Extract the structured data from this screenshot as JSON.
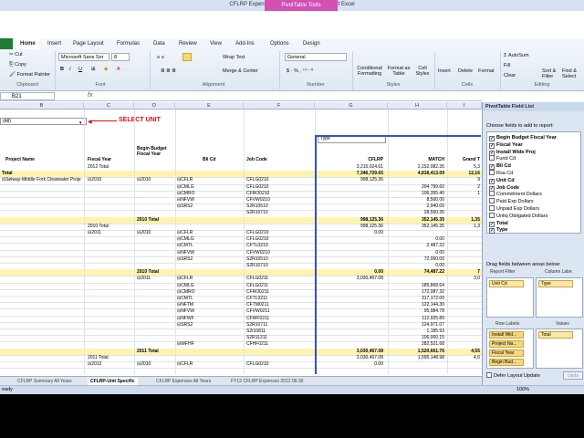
{
  "window": {
    "title": "CFLRP Expenses 2012 09.30.xlsx - Microsoft Excel",
    "tool_tab": "PivotTable Tools"
  },
  "ribbon": {
    "tabs": [
      "Home",
      "Insert",
      "Page Layout",
      "Formulas",
      "Data",
      "Review",
      "View",
      "Add-Ins",
      "Options",
      "Design"
    ],
    "clipboard": {
      "cut": "Cut",
      "copy": "Copy",
      "format_painter": "Format Painter",
      "label": "Clipboard"
    },
    "font": {
      "name": "Microsoft Sans Ser",
      "size": "8",
      "label": "Font"
    },
    "alignment": {
      "wrap": "Wrap Text",
      "merge": "Merge & Center",
      "label": "Alignment"
    },
    "number": {
      "format": "General",
      "label": "Number"
    },
    "styles": {
      "conditional": "Conditional Formatting",
      "format_table": "Format as Table",
      "cell_styles": "Cell Styles",
      "label": "Styles"
    },
    "cells": {
      "insert": "Insert",
      "delete": "Delete",
      "format": "Format",
      "label": "Cells"
    },
    "editing": {
      "autosum": "AutoSum",
      "fill": "Fill",
      "clear": "Clear",
      "sort": "Sort & Filter",
      "find": "Find & Select",
      "label": "Editing"
    }
  },
  "formula_bar": {
    "name_box": "B21",
    "fx": "fx",
    "value": ""
  },
  "columns": [
    "B",
    "C",
    "D",
    "E",
    "F",
    "G",
    "H",
    "I"
  ],
  "annotation": "SELECT UNIT",
  "filter_value": "(All)",
  "headers": {
    "project": "Project Name",
    "fiscal": "Fiscal Year",
    "bbfy": "Begin Budget Fiscal Year",
    "blicd": "Bli Cd",
    "job": "Job Code",
    "type": "Type",
    "cflrp": "CFLRP",
    "match": "MATCH",
    "grand": "Grand T"
  },
  "rows": [
    {
      "fy": "2012 Total",
      "cflrp": "3,215,024.61",
      "match": "2,152,082.35",
      "grand": "5,3"
    },
    {
      "c": "Total",
      "cflrp": "7,346,729.65",
      "match": "4,818,413.09",
      "grand": "12,16",
      "bold": true,
      "yellow": true
    },
    {
      "proj": "⊟Selway-Middle Fork Clearwater Proje",
      "fy": "⊟2010",
      "bb": "⊟2010",
      "bli": "⊟CFLR",
      "job": "CFLG0210",
      "cflrp": "998,125.36",
      "grand": "9"
    },
    {
      "bli": "⊟CMLG",
      "job": "CFLG0210",
      "match": "204,799.60",
      "grand": "2"
    },
    {
      "bli": "⊟CMRO",
      "job": "CFRO0210",
      "match": "106,355.40",
      "grand": "1"
    },
    {
      "bli": "⊟NFVW",
      "job": "CFVW0210",
      "match": "8,500.00"
    },
    {
      "bli": "⊟SRS2",
      "job": "S2R10510",
      "match": "2,940.00"
    },
    {
      "job": "S2R10710",
      "match": "28,550.35"
    },
    {
      "bb": "2010 Total",
      "cflrp": "998,125.36",
      "match": "352,145.35",
      "grand": "1,35",
      "bold": true,
      "yellow": true
    },
    {
      "fy": "2010 Total",
      "cflrp": "998,125.36",
      "match": "352,145.35",
      "grand": "1,3"
    },
    {
      "fy": "⊟2011",
      "bb": "⊟2010",
      "bli": "⊟CFLR",
      "job": "CFLG0210",
      "cflrp": "0.00"
    },
    {
      "bli": "⊟CMLG",
      "job": "CFLG0210",
      "match": "0.00"
    },
    {
      "bli": "⊟CMTL",
      "job": "CFTL0210",
      "match": "2,487.22"
    },
    {
      "bli": "⊟NFVW",
      "job": "CFVW0210",
      "match": "0.00"
    },
    {
      "bli": "⊟SRS2",
      "job": "S2R10510",
      "match": "72,000.00"
    },
    {
      "job": "S2R10710",
      "match": "0.00"
    },
    {
      "bb": "2010 Total",
      "cflrp": "0.00",
      "match": "74,487.22",
      "grand": "7",
      "bold": true,
      "yellow": true
    },
    {
      "bb": "⊟2011",
      "bli": "⊟CFLR",
      "job": "CFLG0211",
      "cflrp": "3,030,467.08",
      "grand": "3,0"
    },
    {
      "bli": "⊟CMLG",
      "job": "CFLG0211",
      "match": "185,868.64"
    },
    {
      "bli": "⊟CMRO",
      "job": "CFRO0211",
      "match": "172,087.32"
    },
    {
      "bli": "⊟CMTL",
      "job": "CFTL0211",
      "match": "317,172.00"
    },
    {
      "bli": "⊟NFTM",
      "job": "CFTM0211",
      "match": "122,144.30"
    },
    {
      "bli": "⊟NFVW",
      "job": "CFVW0211",
      "match": "95,984.78"
    },
    {
      "bli": "⊟NFWF",
      "job": "CFWF0211",
      "match": "112,925.89"
    },
    {
      "bli": "⊟SRS2",
      "job": "S2R10711",
      "match": "124,971.07"
    },
    {
      "job": "S2I10811",
      "match": "1,185.93"
    },
    {
      "job": "S2R11311",
      "match": "106,000.15"
    },
    {
      "bli": "⊟WFHF",
      "job": "CFHF0211",
      "match": "282,521.68"
    },
    {
      "bb": "2011 Total",
      "cflrp": "3,030,467.08",
      "match": "1,520,661.76",
      "grand": "4,55",
      "bold": true,
      "yellow": true
    },
    {
      "fy": "2011 Total",
      "cflrp": "3,030,467.08",
      "match": "1,595,148.98",
      "grand": "4,6"
    },
    {
      "fy": "⊟2012",
      "bb": "⊟2010",
      "bli": "⊟CFLR",
      "job": "CFLG0210",
      "cflrp": "0.00"
    }
  ],
  "sheet_tabs": [
    "CFLRP Summary All Years",
    "CFLRP-Unit Specific",
    "CFLRP Expenses All Years",
    "FY12 CFLRP Expenses 2012 09.30"
  ],
  "status": {
    "left": "eady",
    "zoom": "100%"
  },
  "field_list": {
    "title": "PivotTable Field List",
    "prompt": "Choose fields to add to report:",
    "fields": [
      {
        "label": "Begin Budget Fiscal Year",
        "checked": true
      },
      {
        "label": "Fiscal Year",
        "checked": true
      },
      {
        "label": "Install Wide Proj",
        "checked": true
      },
      {
        "label": "Fund Cd",
        "checked": false
      },
      {
        "label": "Bli Cd",
        "checked": true
      },
      {
        "label": "Rsa Cd",
        "checked": false
      },
      {
        "label": "Unit Cd",
        "checked": true
      },
      {
        "label": "Job Code",
        "checked": true
      },
      {
        "label": "Commitment Dollars",
        "checked": false
      },
      {
        "label": "Paid Exp Dollars",
        "checked": false
      },
      {
        "label": "Unpaid Exp Dollars",
        "checked": false
      },
      {
        "label": "Unliq Obligated Dollars",
        "checked": false
      },
      {
        "label": "Total",
        "checked": true
      },
      {
        "label": "Type",
        "checked": true
      }
    ],
    "drag_prompt": "Drag fields between areas below:",
    "report_filter": "Report Filter",
    "column_labels": "Column Labe",
    "filter_item": "Unit Cd",
    "column_item": "Type",
    "row_labels": "Row Labels",
    "values": "Values",
    "row_items": [
      "Install Wid...",
      "Project Na...",
      "Fiscal Year",
      "Begin Bud..."
    ],
    "value_item": "Total",
    "defer": "Defer Layout Update",
    "update": "Upda"
  }
}
